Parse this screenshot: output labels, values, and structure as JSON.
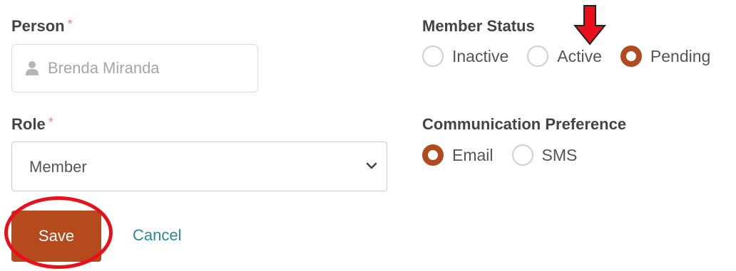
{
  "person": {
    "label": "Person",
    "required_mark": "*",
    "value": "Brenda Miranda",
    "icon": "user-icon"
  },
  "role": {
    "label": "Role",
    "required_mark": "*",
    "selected": "Member",
    "icon": "chevron-down-icon"
  },
  "member_status": {
    "label": "Member Status",
    "options": [
      {
        "label": "Inactive",
        "checked": false
      },
      {
        "label": "Active",
        "checked": false
      },
      {
        "label": "Pending",
        "checked": true
      }
    ]
  },
  "communication": {
    "label": "Communication Preference",
    "options": [
      {
        "label": "Email",
        "checked": true
      },
      {
        "label": "SMS",
        "checked": false
      }
    ]
  },
  "actions": {
    "save_label": "Save",
    "cancel_label": "Cancel"
  },
  "annotations": {
    "arrow_target": "Active",
    "circle_target": "Save",
    "color": "#e8101a"
  },
  "colors": {
    "accent": "#b54a1c",
    "link": "#2a8a8e",
    "required": "#e08a80"
  }
}
